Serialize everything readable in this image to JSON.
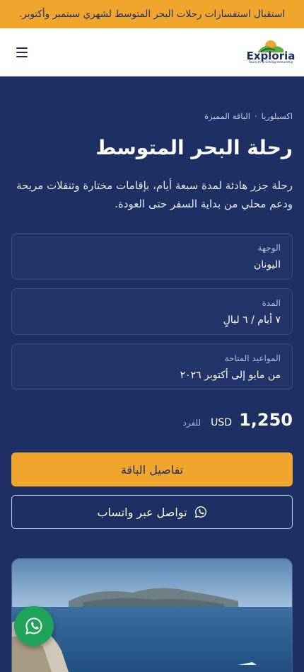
{
  "announcement": "استقبال استفسارات رحلات البحر المتوسط لشهري سبتمبر وأكتوبر.",
  "header": {
    "logo_word": "Exploria",
    "logo_tagline": "Tourism & Entrepreneurship"
  },
  "breadcrumb": {
    "items": [
      "اكسبلوريا",
      "الباقة المميزة"
    ],
    "separator": "·"
  },
  "package": {
    "title": "رحلة البحر المتوسط",
    "description": "رحلة جزر هادئة لمدة سبعة أيام، بإقامات مختارة وتنقلات مريحة ودعم محلي من بداية السفر حتى العودة."
  },
  "details": [
    {
      "label": "الوجهة",
      "value": "اليونان"
    },
    {
      "label": "المدة",
      "value": "٧ أيام / ٦ ليالٍ"
    },
    {
      "label": "المواعيد المتاحة",
      "value": "من مايو إلى أكتوبر ٢٠٢٦"
    }
  ],
  "price": {
    "amount": "1,250",
    "currency": "USD",
    "per": "للفرد"
  },
  "actions": {
    "details_label": "تفاصيل الباقة",
    "whatsapp_label": "تواصل عبر واتساب"
  },
  "icons": {
    "menu": "menu-icon",
    "whatsapp": "whatsapp-icon",
    "logo": "exploria-logo"
  },
  "colors": {
    "brand_navy": "#1d2f63",
    "accent_orange": "#f0a52c",
    "whatsapp_green": "#1fa25a"
  }
}
